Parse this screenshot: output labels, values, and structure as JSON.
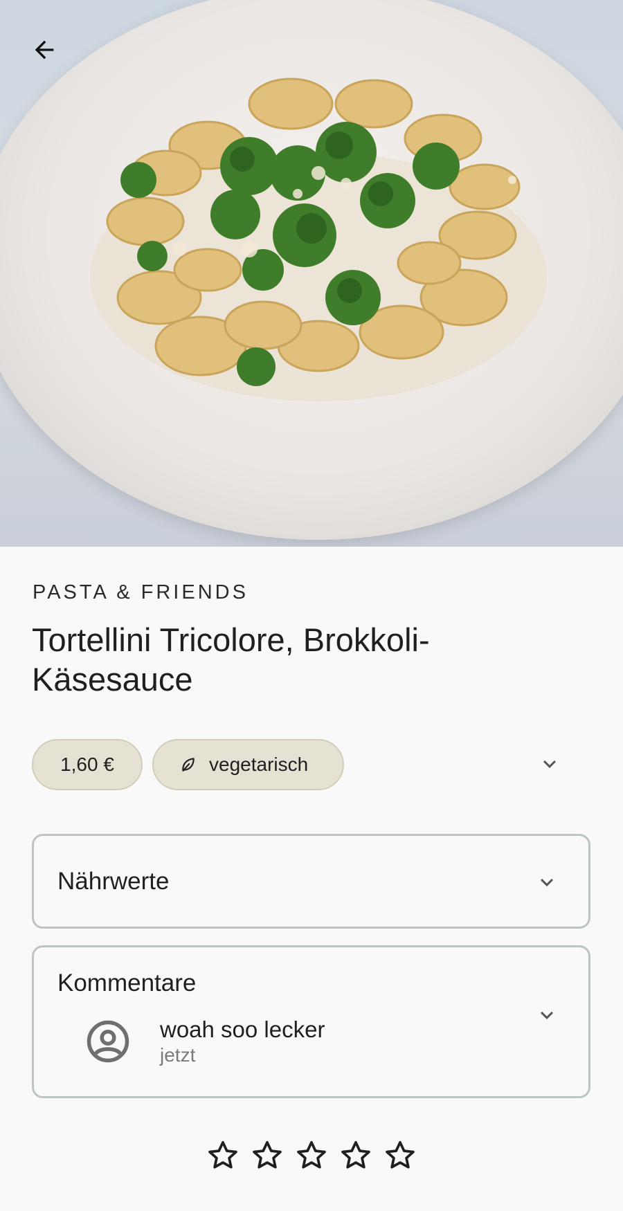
{
  "header": {
    "back_icon": "arrow-left-icon",
    "image_subject": "dish-photo"
  },
  "dish": {
    "category": "PASTA & FRIENDS",
    "title": "Tortellini Tricolore, Brokkoli-Käsesauce",
    "price": "1,60 €",
    "tag": {
      "icon": "leaf-icon",
      "label": "vegetarisch"
    }
  },
  "sections": {
    "nutrition": {
      "title": "Nährwerte",
      "icon": "chevron-down-icon"
    },
    "comments": {
      "title": "Kommentare",
      "icon": "chevron-down-icon",
      "items": [
        {
          "avatar_icon": "account-circle-icon",
          "text": "woah soo lecker",
          "time": "jetzt"
        }
      ]
    }
  },
  "rating": {
    "max": 5,
    "value": 0,
    "icon": "star-outline-icon"
  },
  "colors": {
    "background": "#f9f9f9",
    "chip_background": "#e5e1d3",
    "chip_border": "#d2cdb9",
    "card_border": "#bcc5c4",
    "text_primary": "#1f1f1f",
    "text_secondary": "#7a7a7a"
  }
}
